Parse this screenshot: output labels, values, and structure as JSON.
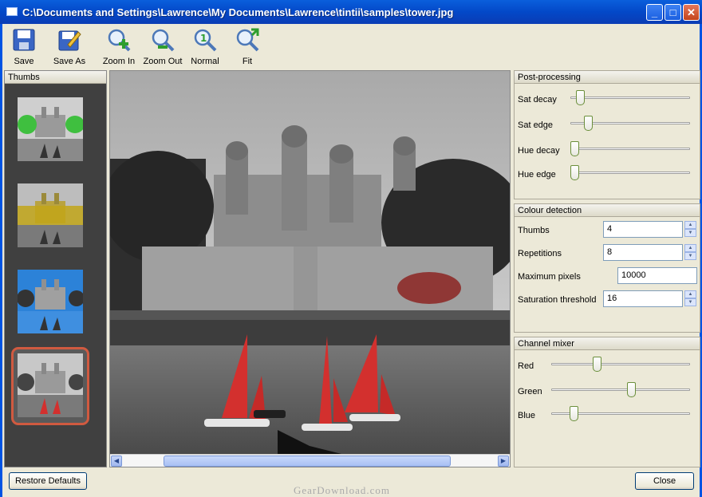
{
  "window": {
    "title": "C:\\Documents and Settings\\Lawrence\\My Documents\\Lawrence\\tintii\\samples\\tower.jpg"
  },
  "toolbar": {
    "save": "Save",
    "save_as": "Save As",
    "zoom_in": "Zoom In",
    "zoom_out": "Zoom Out",
    "normal": "Normal",
    "fit": "Fit"
  },
  "thumbs": {
    "title": "Thumbs"
  },
  "post_processing": {
    "title": "Post-processing",
    "sat_decay": {
      "label": "Sat decay",
      "value": 0.05
    },
    "sat_edge": {
      "label": "Sat edge",
      "value": 0.12
    },
    "hue_decay": {
      "label": "Hue decay",
      "value": 0.0
    },
    "hue_edge": {
      "label": "Hue edge",
      "value": 0.0
    }
  },
  "colour_detection": {
    "title": "Colour detection",
    "thumbs": {
      "label": "Thumbs",
      "value": "4"
    },
    "repetitions": {
      "label": "Repetitions",
      "value": "8"
    },
    "maximum_pixels": {
      "label": "Maximum pixels",
      "value": "10000"
    },
    "saturation_threshold": {
      "label": "Saturation threshold",
      "value": "16"
    }
  },
  "channel_mixer": {
    "title": "Channel mixer",
    "red": {
      "label": "Red",
      "value": 0.32
    },
    "green": {
      "label": "Green",
      "value": 0.58
    },
    "blue": {
      "label": "Blue",
      "value": 0.14
    }
  },
  "buttons": {
    "restore_defaults": "Restore Defaults",
    "close": "Close"
  },
  "watermark": "GearDownload.com"
}
